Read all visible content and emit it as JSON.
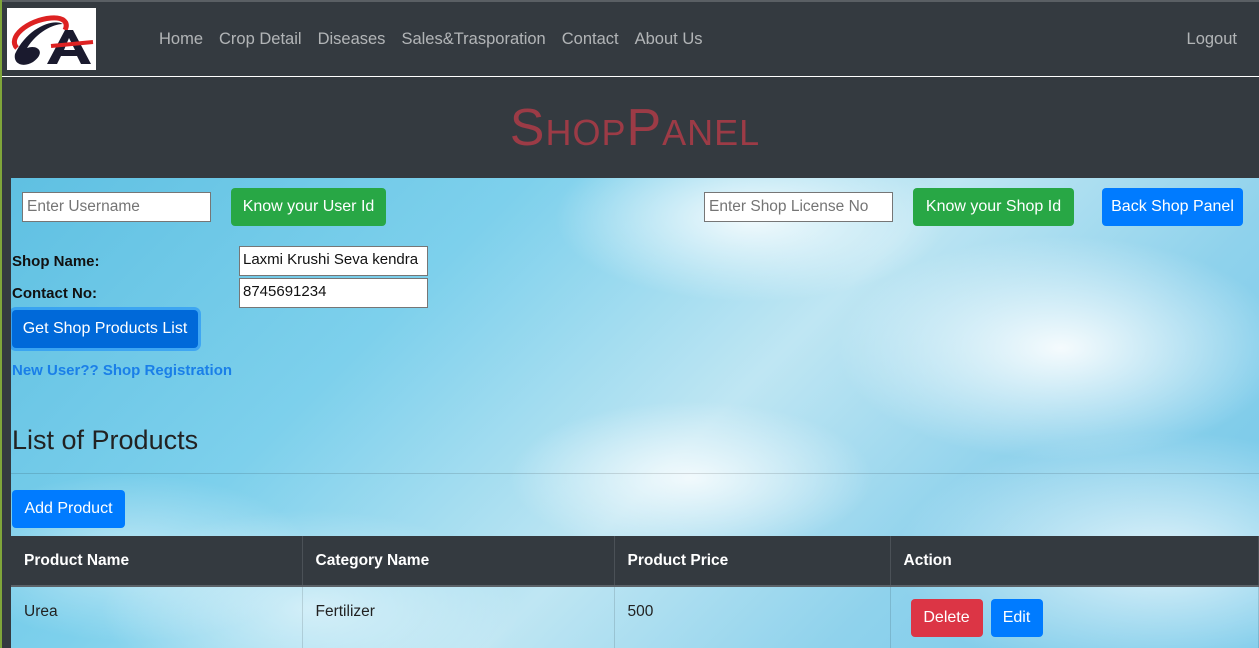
{
  "nav": {
    "items": [
      "Home",
      "Crop Detail",
      "Diseases",
      "Sales&Trasporation",
      "Contact",
      "About Us"
    ],
    "logout": "Logout"
  },
  "hero": {
    "title": "ShopPanel"
  },
  "toolbar": {
    "username_placeholder": "Enter Username",
    "user_id_button": "Know your User Id",
    "license_placeholder": "Enter Shop License No",
    "shop_id_button": "Know your Shop Id",
    "back_button": "Back Shop Panel"
  },
  "shop": {
    "name_label": "Shop Name:",
    "name_value": "Laxmi Krushi Seva kendra",
    "contact_label": "Contact No:",
    "contact_value": "8745691234",
    "get_products_button": "Get Shop Products List",
    "registration_link": "New User?? Shop Registration"
  },
  "products": {
    "heading": "List of Products",
    "add_button": "Add Product",
    "columns": [
      "Product Name",
      "Category Name",
      "Product Price",
      "Action"
    ],
    "rows": [
      {
        "name": "Urea",
        "category": "Fertilizer",
        "price": "500"
      }
    ],
    "delete_label": "Delete",
    "edit_label": "Edit"
  },
  "colors": {
    "navbar": "#343a40",
    "title": "#9c3b46",
    "green": "#28a745",
    "blue": "#007bff",
    "red": "#dc3545"
  }
}
